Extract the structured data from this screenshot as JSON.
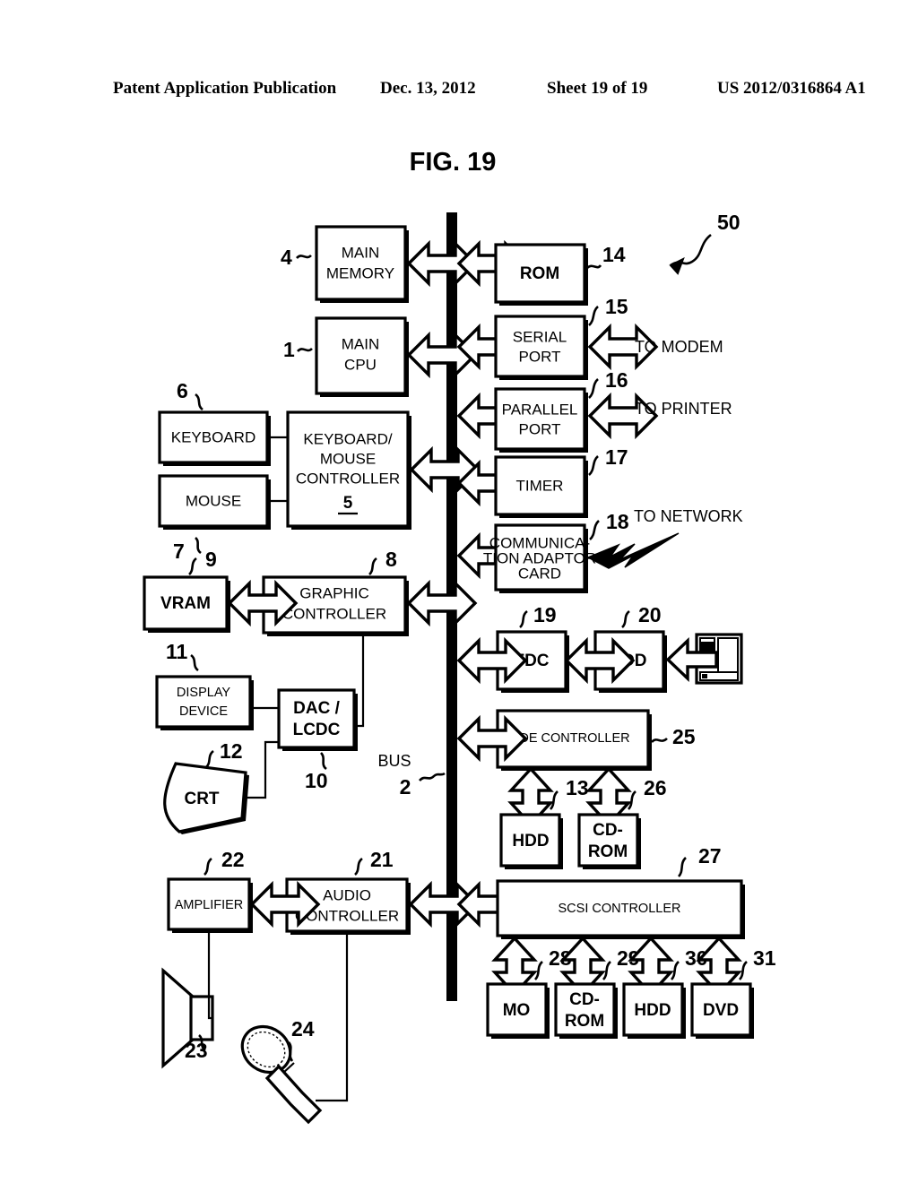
{
  "header": {
    "publication": "Patent Application Publication",
    "date": "Dec. 13, 2012",
    "sheet": "Sheet 19 of 19",
    "number": "US 2012/0316864 A1"
  },
  "figure": {
    "title": "FIG. 19",
    "system_ref": "50",
    "bus_label": "BUS",
    "bus_ref": "2"
  },
  "blocks": {
    "main_memory": {
      "label_line1": "MAIN",
      "label_line2": "MEMORY",
      "ref": "4"
    },
    "main_cpu": {
      "label_line1": "MAIN",
      "label_line2": "CPU",
      "ref": "1"
    },
    "keyboard": {
      "label": "KEYBOARD",
      "ref": "6"
    },
    "mouse": {
      "label": "MOUSE",
      "ref": "7"
    },
    "kbd_mouse_controller": {
      "label_line1": "KEYBOARD/",
      "label_line2": "MOUSE",
      "label_line3": "CONTROLLER",
      "ref_inside": "5"
    },
    "vram": {
      "label": "VRAM",
      "ref": "9"
    },
    "graphic_controller": {
      "label_line1": "GRAPHIC",
      "label_line2": "CONTROLLER",
      "ref": "8"
    },
    "display_device": {
      "label_line1": "DISPLAY",
      "label_line2": "DEVICE",
      "ref": "11"
    },
    "dac_lcdc": {
      "label_line1": "DAC /",
      "label_line2": "LCDC",
      "ref": "10"
    },
    "crt": {
      "label": "CRT",
      "ref": "12"
    },
    "amplifier": {
      "label": "AMPLIFIER",
      "ref": "22"
    },
    "speaker": {
      "ref": "23"
    },
    "audio_controller": {
      "label_line1": "AUDIO",
      "label_line2": "CONTROLLER",
      "ref": "21"
    },
    "microphone": {
      "ref": "24"
    },
    "rom": {
      "label": "ROM",
      "ref": "14"
    },
    "serial_port": {
      "label_line1": "SERIAL",
      "label_line2": "PORT",
      "ref": "15"
    },
    "parallel_port": {
      "label_line1": "PARALLEL",
      "label_line2": "PORT",
      "ref": "16"
    },
    "timer": {
      "label": "TIMER",
      "ref": "17"
    },
    "comm_adaptor_card": {
      "label_line1": "COMMUNICA-",
      "label_line2": "TION ADAPTOR",
      "label_line3": "CARD",
      "ref": "18"
    },
    "fdc": {
      "label": "FDC",
      "ref": "19"
    },
    "fdd": {
      "label": "FDD",
      "ref": "20"
    },
    "ide_controller": {
      "label": "IDE CONTROLLER",
      "ref": "25"
    },
    "ide_hdd": {
      "label": "HDD",
      "ref": "13"
    },
    "ide_cdrom": {
      "label_line1": "CD-",
      "label_line2": "ROM",
      "ref": "26"
    },
    "scsi_controller": {
      "label": "SCSI CONTROLLER",
      "ref": "27"
    },
    "scsi_mo": {
      "label": "MO",
      "ref": "28"
    },
    "scsi_cdrom": {
      "label_line1": "CD-",
      "label_line2": "ROM",
      "ref": "29"
    },
    "scsi_hdd": {
      "label": "HDD",
      "ref": "30"
    },
    "scsi_dvd": {
      "label": "DVD",
      "ref": "31"
    }
  },
  "external_labels": {
    "to_modem": "TO MODEM",
    "to_printer": "TO PRINTER",
    "to_network": "TO NETWORK"
  }
}
